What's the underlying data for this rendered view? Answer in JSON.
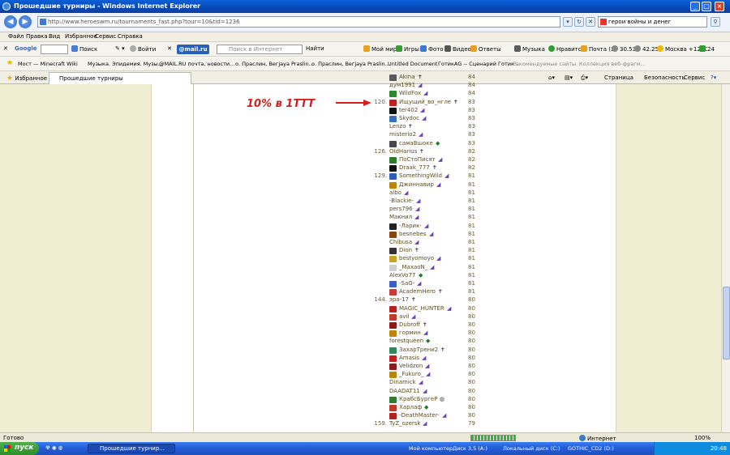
{
  "window": {
    "title": "Прошедшие турниры - Windows Internet Explorer"
  },
  "address": {
    "url": "http://www.heroeswm.ru/tournaments_fast.php?tour=10&tid=1236",
    "search_text": "герои войны и денег"
  },
  "menu": [
    "Файл",
    "Правка",
    "Вид",
    "Избранное",
    "Сервис",
    "Справка"
  ],
  "toolbar": {
    "google_label": "Google",
    "search_label": "Поиск",
    "login_label": "Войти",
    "mail_label": "@mail.ru",
    "mail_search_placeholder": "Поиск в Интернет",
    "find_label": "Найти",
    "items": [
      "Мой мир",
      "Игры",
      "Фото",
      "Видео",
      "Ответы",
      "Музыка",
      "Нравится",
      "Почта (1)",
      "30.53",
      "42.25",
      "Москва +12°C",
      "24"
    ]
  },
  "favorites": {
    "label": "Избранное",
    "items": [
      "Мост — Minecraft Wiki",
      "Музыка. Эпидемия. Музы...",
      "@MAIL.RU почта, новости...",
      "о. Праслин, Вегjaya Praslin...",
      "о. Праслин, Вегjaya Praslin...",
      "Untitled Document",
      "ГотикАG -- Сценарий Готик...",
      "Рекомендуемые сайты",
      "Коллекция веб-фрагм..."
    ]
  },
  "tab": {
    "active_label": "Прошедшие турниры",
    "page_label": "Страница",
    "security_label": "Безопасность",
    "service_label": "Сервис"
  },
  "annotation": {
    "text": "10% в 1ТТТ"
  },
  "ranking": [
    {
      "rank": "",
      "name": "Akina",
      "score": "84",
      "icon": "#5A5A5A",
      "mark": "✝",
      "mark_kind": "gray"
    },
    {
      "rank": "",
      "name": "дум1991",
      "score": "84",
      "icon": "",
      "mark": "◢",
      "mark_kind": "purple"
    },
    {
      "rank": "",
      "name": "WildFox",
      "score": "84",
      "icon": "#2C8A2C",
      "mark": "◢",
      "mark_kind": "purple"
    },
    {
      "rank": "120.",
      "name": "Ищущий_во_нгле",
      "score": "83",
      "icon": "#C41E1E",
      "mark": "✝",
      "mark_kind": "gray"
    },
    {
      "rank": "",
      "name": "ter402",
      "score": "83",
      "icon": "#111111",
      "mark": "◢",
      "mark_kind": "purple"
    },
    {
      "rank": "",
      "name": "Skydoc",
      "score": "83",
      "icon": "#3D6FB8",
      "mark": "◢",
      "mark_kind": "purple"
    },
    {
      "rank": "",
      "name": "Lenzo",
      "score": "83",
      "icon": "",
      "mark": "✝",
      "mark_kind": "gray"
    },
    {
      "rank": "",
      "name": "misterio2",
      "score": "83",
      "icon": "",
      "mark": "◢",
      "mark_kind": "purple"
    },
    {
      "rank": "",
      "name": "самаВшоке",
      "score": "83",
      "icon": "#4A4A4A",
      "mark": "◆",
      "mark_kind": "green"
    },
    {
      "rank": "126.",
      "name": "OldHarius",
      "score": "82",
      "icon": "",
      "mark": "✝",
      "mark_kind": "gray"
    },
    {
      "rank": "",
      "name": "ПоСтоПисят",
      "score": "82",
      "icon": "#2E7A2E",
      "mark": "◢",
      "mark_kind": "purple"
    },
    {
      "rank": "",
      "name": "Draak_777",
      "score": "82",
      "icon": "#111111",
      "mark": "✝",
      "mark_kind": "gray"
    },
    {
      "rank": "129.",
      "name": "SomethingWild",
      "score": "81",
      "icon": "#2B5FB8",
      "mark": "◢",
      "mark_kind": "purple"
    },
    {
      "rank": "",
      "name": "Джиннавир",
      "score": "81",
      "icon": "#B8860B",
      "mark": "◢",
      "mark_kind": "purple"
    },
    {
      "rank": "",
      "name": "albo",
      "score": "81",
      "icon": "",
      "mark": "◢",
      "mark_kind": "purple"
    },
    {
      "rank": "",
      "name": "-Blackie-",
      "score": "81",
      "icon": "",
      "mark": "◢",
      "mark_kind": "purple"
    },
    {
      "rank": "",
      "name": "pers796",
      "score": "81",
      "icon": "",
      "mark": "◢",
      "mark_kind": "purple"
    },
    {
      "rank": "",
      "name": "Макнил",
      "score": "81",
      "icon": "",
      "mark": "◢",
      "mark_kind": "purple"
    },
    {
      "rank": "",
      "name": "-Ларик-",
      "score": "81",
      "icon": "#222222",
      "mark": "◢",
      "mark_kind": "purple"
    },
    {
      "rank": "",
      "name": "besnebes",
      "score": "81",
      "icon": "#8B4513",
      "mark": "◢",
      "mark_kind": "purple"
    },
    {
      "rank": "",
      "name": "Chibusa",
      "score": "81",
      "icon": "",
      "mark": "◢",
      "mark_kind": "purple"
    },
    {
      "rank": "",
      "name": "Dion",
      "score": "81",
      "icon": "#333333",
      "mark": "✝",
      "mark_kind": "gray"
    },
    {
      "rank": "",
      "name": "bestyomoyo",
      "score": "81",
      "icon": "#C9A227",
      "mark": "◢",
      "mark_kind": "purple"
    },
    {
      "rank": "",
      "name": "_MaxaoN_",
      "score": "81",
      "icon": "#CFCFCF",
      "mark": "◢",
      "mark_kind": "purple"
    },
    {
      "rank": "",
      "name": "AlexVo77",
      "score": "81",
      "icon": "",
      "mark": "◆",
      "mark_kind": "green"
    },
    {
      "rank": "",
      "name": "-SaG-",
      "score": "81",
      "icon": "#3A5FC8",
      "mark": "◢",
      "mark_kind": "purple"
    },
    {
      "rank": "",
      "name": "AcademHero",
      "score": "81",
      "icon": "#C83A3A",
      "mark": "✝",
      "mark_kind": "gray"
    },
    {
      "rank": "144.",
      "name": "эра-17",
      "score": "80",
      "icon": "",
      "mark": "✝",
      "mark_kind": "gray"
    },
    {
      "rank": "",
      "name": "MAGIC_HUNTER",
      "score": "80",
      "icon": "#B22222",
      "mark": "◢",
      "mark_kind": "purple"
    },
    {
      "rank": "",
      "name": "avil",
      "score": "80",
      "icon": "#C0392B",
      "mark": "◢",
      "mark_kind": "purple"
    },
    {
      "rank": "",
      "name": "Dubroff",
      "score": "80",
      "icon": "#8B1A1A",
      "mark": "✝",
      "mark_kind": "gray"
    },
    {
      "rank": "",
      "name": "гормин",
      "score": "80",
      "icon": "#B8860B",
      "mark": "◢",
      "mark_kind": "purple"
    },
    {
      "rank": "",
      "name": "forestqueen",
      "score": "80",
      "icon": "",
      "mark": "◆",
      "mark_kind": "green"
    },
    {
      "rank": "",
      "name": "ЗахарТрени2",
      "score": "80",
      "icon": "#2E8B57",
      "mark": "✝",
      "mark_kind": "gray"
    },
    {
      "rank": "",
      "name": "Amasis",
      "score": "80",
      "icon": "#C41E1E",
      "mark": "◢",
      "mark_kind": "purple"
    },
    {
      "rank": "",
      "name": "Velidzon",
      "score": "80",
      "icon": "#8B1A1A",
      "mark": "◢",
      "mark_kind": "purple"
    },
    {
      "rank": "",
      "name": "_Fukuro_",
      "score": "80",
      "icon": "#B8860B",
      "mark": "◢",
      "mark_kind": "purple"
    },
    {
      "rank": "",
      "name": "Dinamick",
      "score": "80",
      "icon": "",
      "mark": "◢",
      "mark_kind": "purple"
    },
    {
      "rank": "",
      "name": "DAADAT11",
      "score": "80",
      "icon": "",
      "mark": "◢",
      "mark_kind": "purple"
    },
    {
      "rank": "",
      "name": "КрабсБургеР",
      "score": "80",
      "icon": "#2E7D32",
      "mark": "◍",
      "mark_kind": "gray"
    },
    {
      "rank": "",
      "name": "Харлаф",
      "score": "80",
      "icon": "#C0392B",
      "mark": "◆",
      "mark_kind": "green"
    },
    {
      "rank": "",
      "name": "-DeathMaster-",
      "score": "80",
      "icon": "#B22222",
      "mark": "◢",
      "mark_kind": "purple"
    },
    {
      "rank": "159.",
      "name": "TyZ_ozersk",
      "score": "79",
      "icon": "",
      "mark": "◢",
      "mark_kind": "purple"
    }
  ],
  "status": {
    "left": "Готово",
    "zone": "Интернет",
    "zoom": "100%",
    "progress_fraction": 1.0
  },
  "taskbar": {
    "start_label": "пуск",
    "window_label": "Прошедшие турнир...",
    "drives": [
      "Мой компьютер",
      "Диск 3,5 (A:)",
      "Локальный диск (C:)",
      "GOTHIC_CD2 (D:)"
    ],
    "clock": "20:48"
  }
}
